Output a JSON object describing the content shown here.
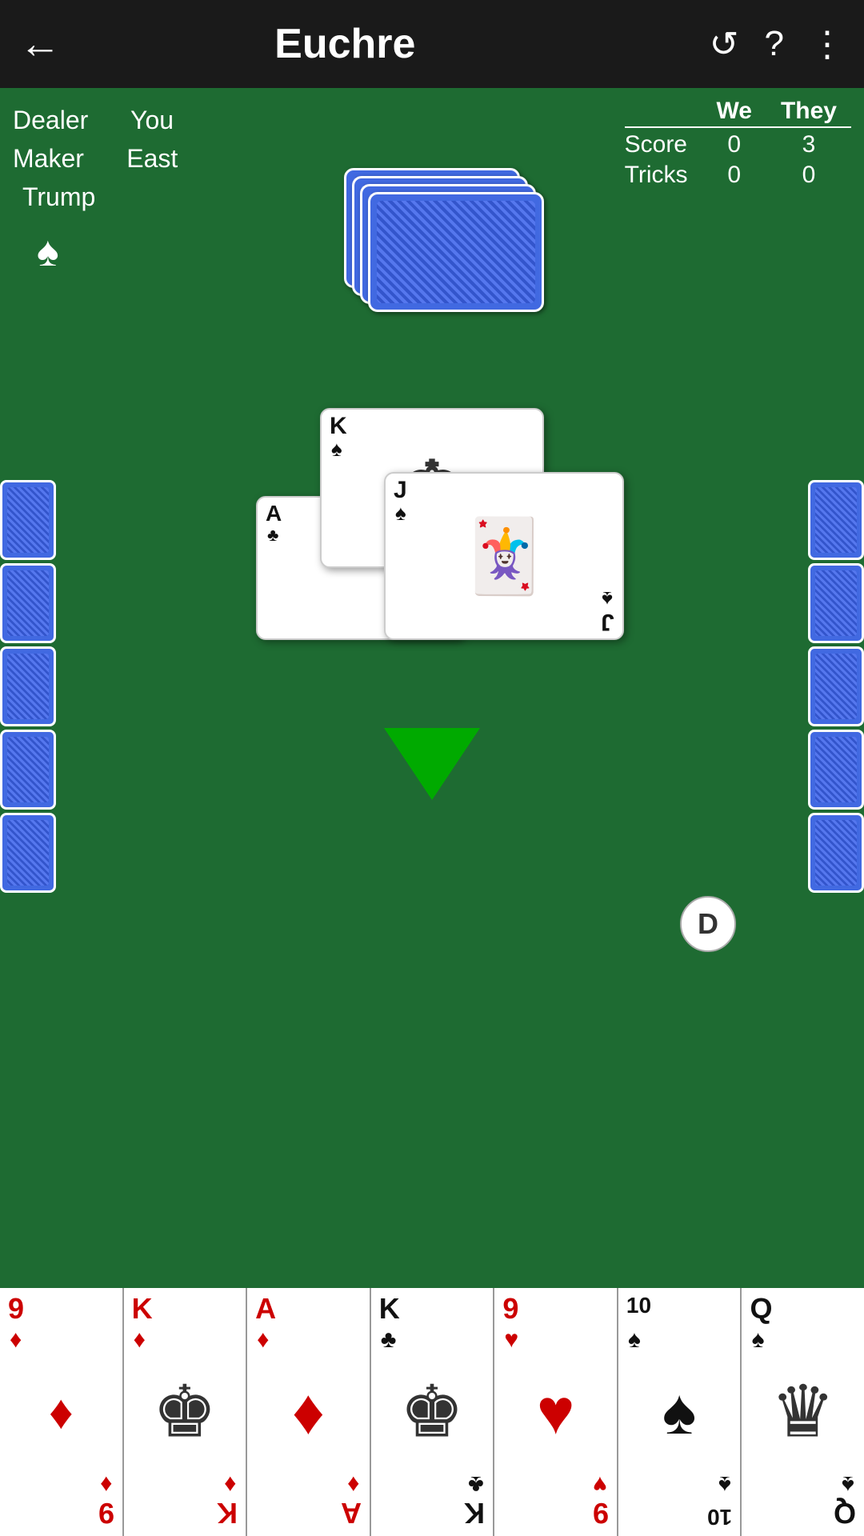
{
  "app": {
    "title": "Euchre"
  },
  "header": {
    "back_label": "←",
    "undo_icon": "↺",
    "help_icon": "?",
    "menu_icon": "⋮"
  },
  "info_panel": {
    "dealer_label": "Dealer",
    "maker_label": "Maker",
    "you_label": "You",
    "east_label": "East",
    "trump_label": "Trump",
    "trump_suit": "♠"
  },
  "score_panel": {
    "we_label": "We",
    "they_label": "They",
    "score_label": "Score",
    "tricks_label": "Tricks",
    "we_score": "0",
    "they_score": "3",
    "we_tricks": "0",
    "they_tricks": "0"
  },
  "play_area": {
    "cards_in_play": [
      {
        "rank": "K",
        "suit": "♠",
        "color": "black"
      },
      {
        "rank": "J",
        "suit": "♠",
        "color": "black"
      },
      {
        "rank": "A",
        "suit": "♣",
        "color": "black"
      }
    ]
  },
  "d_badge": {
    "label": "D"
  },
  "player_hand": {
    "cards": [
      {
        "rank": "9",
        "suit": "♦",
        "color": "red"
      },
      {
        "rank": "K",
        "suit": "♦",
        "color": "red"
      },
      {
        "rank": "A",
        "suit": "♦",
        "color": "red"
      },
      {
        "rank": "K",
        "suit": "♣",
        "color": "black"
      },
      {
        "rank": "9",
        "suit": "♥",
        "color": "red"
      },
      {
        "rank": "10",
        "suit": "♠",
        "color": "black"
      },
      {
        "rank": "Q",
        "suit": "♠",
        "color": "black"
      }
    ]
  },
  "colors": {
    "table_green": "#1e6b32",
    "topbar": "#1a1a1a",
    "card_back_blue": "#4169E1"
  }
}
